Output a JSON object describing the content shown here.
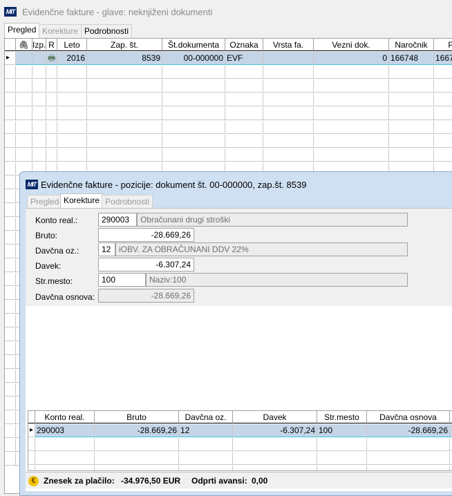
{
  "main": {
    "title": "Evidenčne fakture - glave: neknjiženi dokumenti",
    "tabs": [
      {
        "label": "Pregled"
      },
      {
        "label": "Korekture"
      },
      {
        "label": "Podrobnosti"
      }
    ],
    "columns": [
      "",
      "Izp.",
      "R",
      "Leto",
      "Zap. št.",
      "Št.dokumenta",
      "Oznaka",
      "Vrsta fa.",
      "Vezni dok.",
      "Naročnik",
      "Pla"
    ],
    "row": {
      "leto": "2016",
      "zap": "8539",
      "stdok": "00-000000",
      "oznaka": "EVF",
      "vrsta": "",
      "vezni": "0",
      "narocnik": "166748",
      "pla": "1667"
    },
    "left_partial": "2"
  },
  "child": {
    "title": "Evidenčne fakture - pozicije: dokument št. 00-000000, zap.št. 8539",
    "tabs": [
      {
        "label": "Pregled"
      },
      {
        "label": "Korekture"
      },
      {
        "label": "Podrobnosti"
      }
    ],
    "form": {
      "konto_label": "Konto real.:",
      "konto": "290003",
      "konto_desc": "Obračunani drugi stroški",
      "bruto_label": "Bruto:",
      "bruto": "-28.669,26",
      "davcna_oz_label": "Davčna oz.:",
      "davcna_oz": "12",
      "davcna_oz_desc": "iOBV. ZA OBRAČUNANI DDV 22%",
      "davek_label": "Davek:",
      "davek": "-6.307,24",
      "strmesto_label": "Str.mesto:",
      "strmesto": "100",
      "strmesto_desc": "Naziv:100",
      "osnova_label": "Davčna osnova:",
      "osnova": "-28.669,26"
    },
    "columns": [
      "Konto real.",
      "Bruto",
      "Davčna oz.",
      "Davek",
      "Str.mesto",
      "Davčna osnova"
    ],
    "row": [
      "290003",
      "-28.669,26",
      "12",
      "-6.307,24",
      "100",
      "-28.669,26"
    ],
    "status": {
      "znesek_label": "Znesek za plačilo:",
      "znesek": "-34.976,50 EUR",
      "avansi_label": "Odprti avansi:",
      "avansi": "0,00"
    }
  }
}
